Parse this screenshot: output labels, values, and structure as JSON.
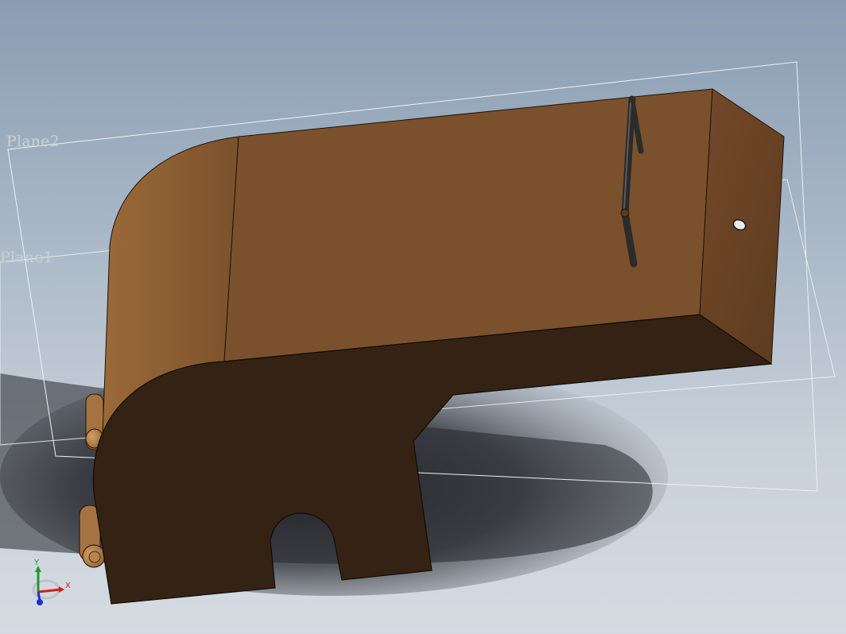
{
  "viewport": {
    "planes": [
      {
        "id": "plane2",
        "label": "Plane2"
      },
      {
        "id": "plane1",
        "label": "Plane1"
      }
    ],
    "triad": {
      "y_label": "Y",
      "x_label": "X"
    },
    "colors": {
      "background_top": "#8a9db2",
      "background_bottom": "#d5dbe1",
      "top_face": "#7a512c",
      "front_face": "#342314",
      "end_face": "#6f4826",
      "rod": "#2b2b2b",
      "plane_outline": "#e9edf1",
      "axis_x": "#d21d1d",
      "axis_y": "#1f9a2c",
      "axis_z": "#1d2fd2"
    }
  }
}
